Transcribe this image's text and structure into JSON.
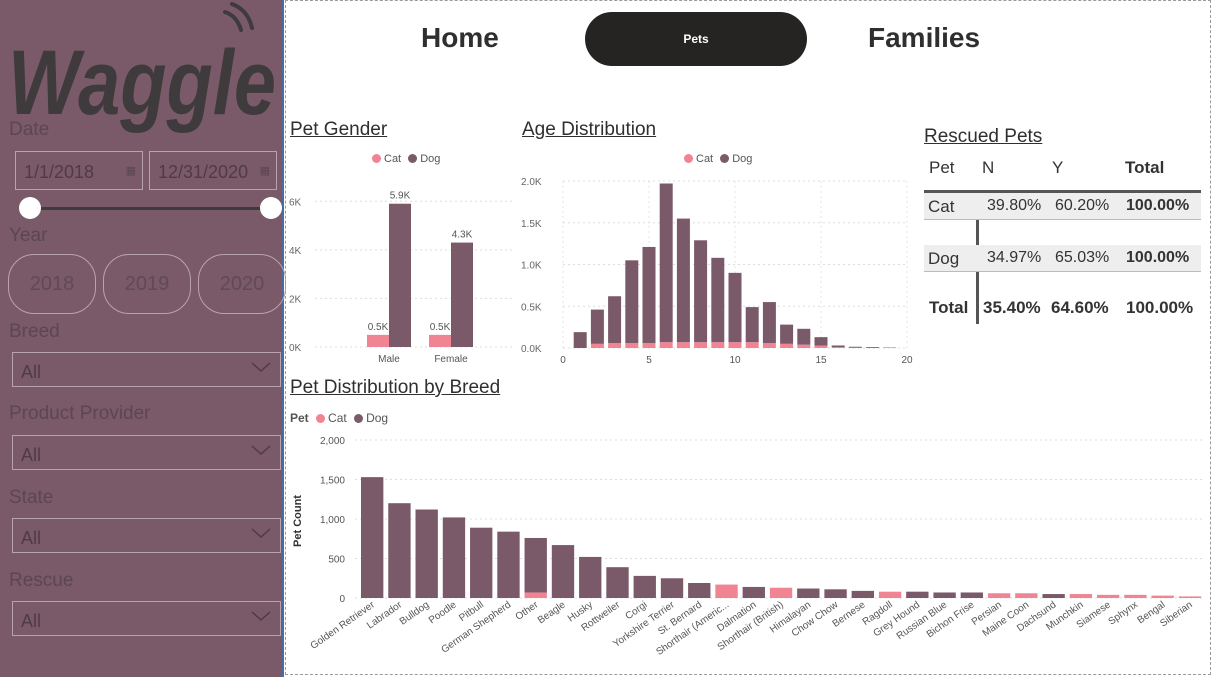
{
  "logo_text": "Waggle",
  "filters": {
    "date_label": "Date",
    "date_start": "1/1/2018",
    "date_end": "12/31/2020",
    "date_icon": "calendar-icon",
    "year_label": "Year",
    "years": [
      "2018",
      "2019",
      "2020"
    ],
    "breed_label": "Breed",
    "breed_value": "All",
    "provider_label": "Product Provider",
    "provider_value": "All",
    "state_label": "State",
    "state_value": "All",
    "rescue_label": "Rescue",
    "rescue_value": "All"
  },
  "nav": {
    "home": "Home",
    "pets": "Pets",
    "families": "Families"
  },
  "colors": {
    "cat": "#f08493",
    "dog": "#7a5a69",
    "sidebar": "#7a5a69",
    "nav_active": "#252423"
  },
  "gender_chart": {
    "title": "Pet Gender",
    "legend": [
      "Cat",
      "Dog"
    ],
    "chart_data": {
      "type": "bar",
      "categories": [
        "Male",
        "Female"
      ],
      "series": [
        {
          "name": "Cat",
          "values": [
            500,
            500
          ],
          "labels": [
            "0.5K",
            "0.5K"
          ]
        },
        {
          "name": "Dog",
          "values": [
            5900,
            4300
          ],
          "labels": [
            "5.9K",
            "4.3K"
          ]
        }
      ],
      "yticks": [
        "0K",
        "2K",
        "4K",
        "6K"
      ],
      "ylim": [
        0,
        6300
      ]
    }
  },
  "age_chart": {
    "title": "Age Distribution",
    "legend": [
      "Cat",
      "Dog"
    ],
    "chart_data": {
      "type": "bar",
      "stacked": true,
      "x": [
        1,
        2,
        3,
        4,
        5,
        6,
        7,
        8,
        9,
        10,
        11,
        12,
        13,
        14,
        15,
        16,
        17,
        18,
        19
      ],
      "series": [
        {
          "name": "Cat",
          "values": [
            0,
            50,
            60,
            60,
            60,
            70,
            70,
            70,
            70,
            70,
            70,
            60,
            50,
            40,
            30,
            10,
            5,
            0,
            0
          ]
        },
        {
          "name": "Dog",
          "values": [
            190,
            410,
            560,
            990,
            1150,
            1900,
            1480,
            1220,
            1010,
            830,
            420,
            490,
            230,
            190,
            100,
            20,
            10,
            10,
            5
          ]
        }
      ],
      "yticks": [
        "0.0K",
        "0.5K",
        "1.0K",
        "1.5K",
        "2.0K"
      ],
      "xticks": [
        "0",
        "5",
        "10",
        "15",
        "20"
      ],
      "xlim": [
        0,
        20
      ],
      "ylim": [
        0,
        2000
      ]
    }
  },
  "rescued_table": {
    "title": "Rescued Pets",
    "headers": [
      "Pet",
      "N",
      "Y",
      "Total"
    ],
    "rows": [
      {
        "pet": "Cat",
        "n": "39.80%",
        "y": "60.20%",
        "total": "100.00%"
      },
      {
        "pet": "Dog",
        "n": "34.97%",
        "y": "65.03%",
        "total": "100.00%"
      }
    ],
    "totals": {
      "label": "Total",
      "n": "35.40%",
      "y": "64.60%",
      "total": "100.00%"
    }
  },
  "breed_chart": {
    "title": "Pet Distribution by Breed",
    "legend_title": "Pet",
    "legend": [
      "Cat",
      "Dog"
    ],
    "ylabel": "Pet Count",
    "chart_data": {
      "type": "bar",
      "stacked": true,
      "categories": [
        "Golden Retriever",
        "Labrador",
        "Bulldog",
        "Poodle",
        "Pitbull",
        "German Shepherd",
        "Other",
        "Beagle",
        "Husky",
        "Rottweiler",
        "Corgi",
        "Yorkshire Terrier",
        "St. Bernard",
        "Shorthair (Americ...",
        "Dalmation",
        "Shorthair (British)",
        "Himalayan",
        "Chow Chow",
        "Bernese",
        "Ragdoll",
        "Grey Hound",
        "Russian Blue",
        "Bichon Frise",
        "Persian",
        "Maine Coon",
        "Dachsund",
        "Munchkin",
        "Siamese",
        "Sphynx",
        "Bengal",
        "Siberian"
      ],
      "series": [
        {
          "name": "Cat",
          "values": [
            0,
            0,
            0,
            0,
            0,
            0,
            70,
            0,
            0,
            0,
            0,
            0,
            0,
            170,
            0,
            130,
            0,
            0,
            0,
            80,
            0,
            0,
            0,
            60,
            60,
            0,
            50,
            40,
            40,
            30,
            20
          ]
        },
        {
          "name": "Dog",
          "values": [
            1530,
            1200,
            1120,
            1020,
            890,
            840,
            690,
            670,
            520,
            390,
            280,
            250,
            190,
            0,
            140,
            0,
            120,
            110,
            90,
            0,
            80,
            70,
            70,
            0,
            0,
            50,
            0,
            0,
            0,
            0,
            0
          ]
        }
      ],
      "yticks": [
        "0",
        "500",
        "1,000",
        "1,500",
        "2,000"
      ],
      "ylim": [
        0,
        2000
      ]
    }
  }
}
